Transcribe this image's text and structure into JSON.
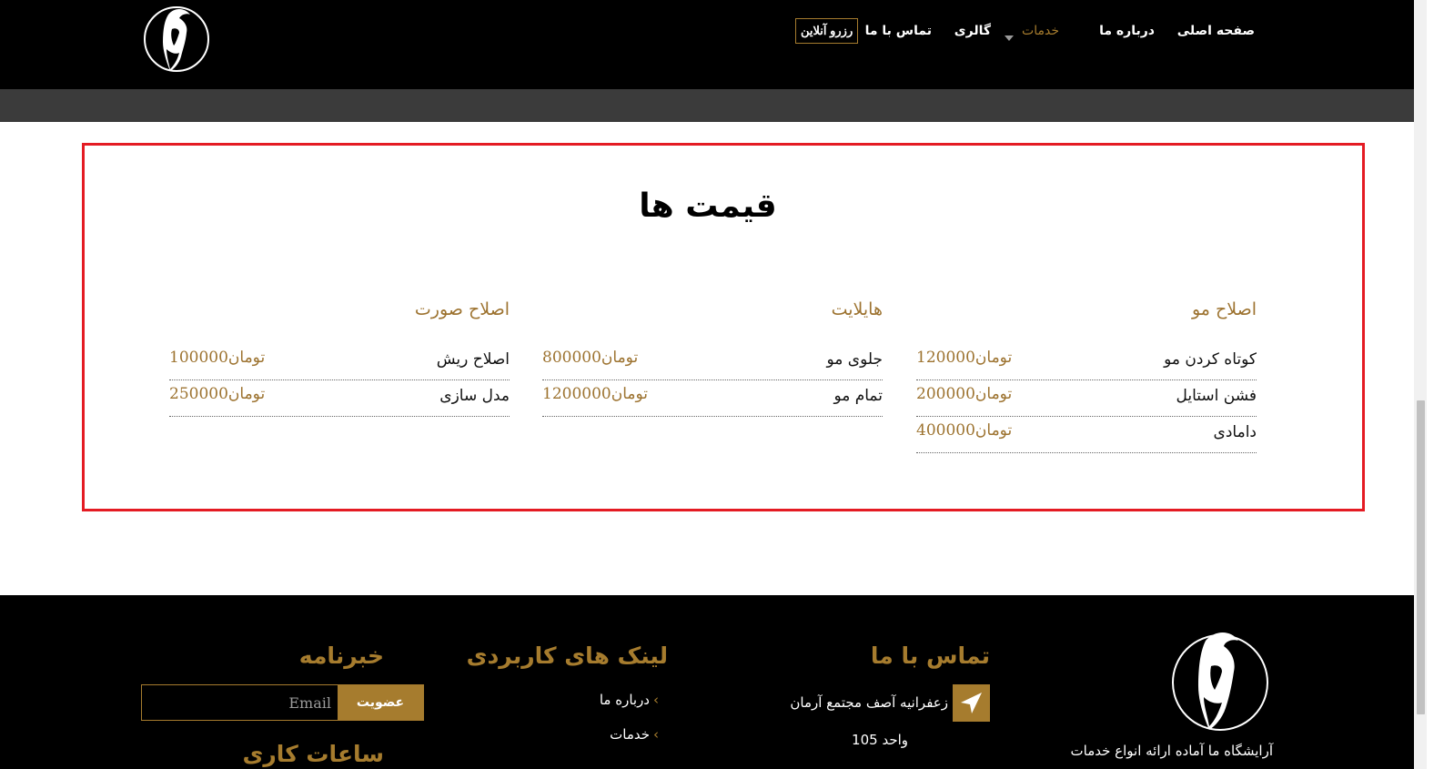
{
  "header": {
    "nav": {
      "home": "صفحه اصلی",
      "about": "درباره ما",
      "services": "خدمات",
      "gallery": "گالری",
      "contact": "تماس با ما",
      "reserve": "رزرو آنلاین"
    },
    "colors": {
      "background": "#000000",
      "accent": "#a67c2e",
      "subbar": "#3b3b3b"
    }
  },
  "prices": {
    "title": "قیمت ها",
    "highlight_color": "#e41b23",
    "columns": [
      {
        "title": "اصلاح مو",
        "items": [
          {
            "name": "کوتاه کردن مو",
            "price": "120000تومان"
          },
          {
            "name": "فشن استایل",
            "price": "200000تومان"
          },
          {
            "name": "دامادی",
            "price": "400000تومان"
          }
        ]
      },
      {
        "title": "هایلایت",
        "items": [
          {
            "name": "جلوی مو",
            "price": "800000تومان"
          },
          {
            "name": "تمام مو",
            "price": "1200000تومان"
          }
        ]
      },
      {
        "title": "اصلاح صورت",
        "items": [
          {
            "name": "اصلاح ریش",
            "price": "100000تومان"
          },
          {
            "name": "مدل سازی",
            "price": "250000تومان"
          }
        ]
      }
    ]
  },
  "footer": {
    "contact": {
      "title": "تماس با ما",
      "address": "زعفرانیه آصف مجتمع آرمان",
      "unit": "واحد 105"
    },
    "links": {
      "title": "لینک های کاربردی",
      "items": [
        "درباره ما",
        "خدمات"
      ]
    },
    "newsletter": {
      "title": "خبرنامه",
      "email_placeholder": "Email",
      "subscribe_label": "عضویت"
    },
    "tagline": "آرایشگاه ما آماده ارائه انواع خدمات",
    "partial_title": "ساعات کاری"
  }
}
